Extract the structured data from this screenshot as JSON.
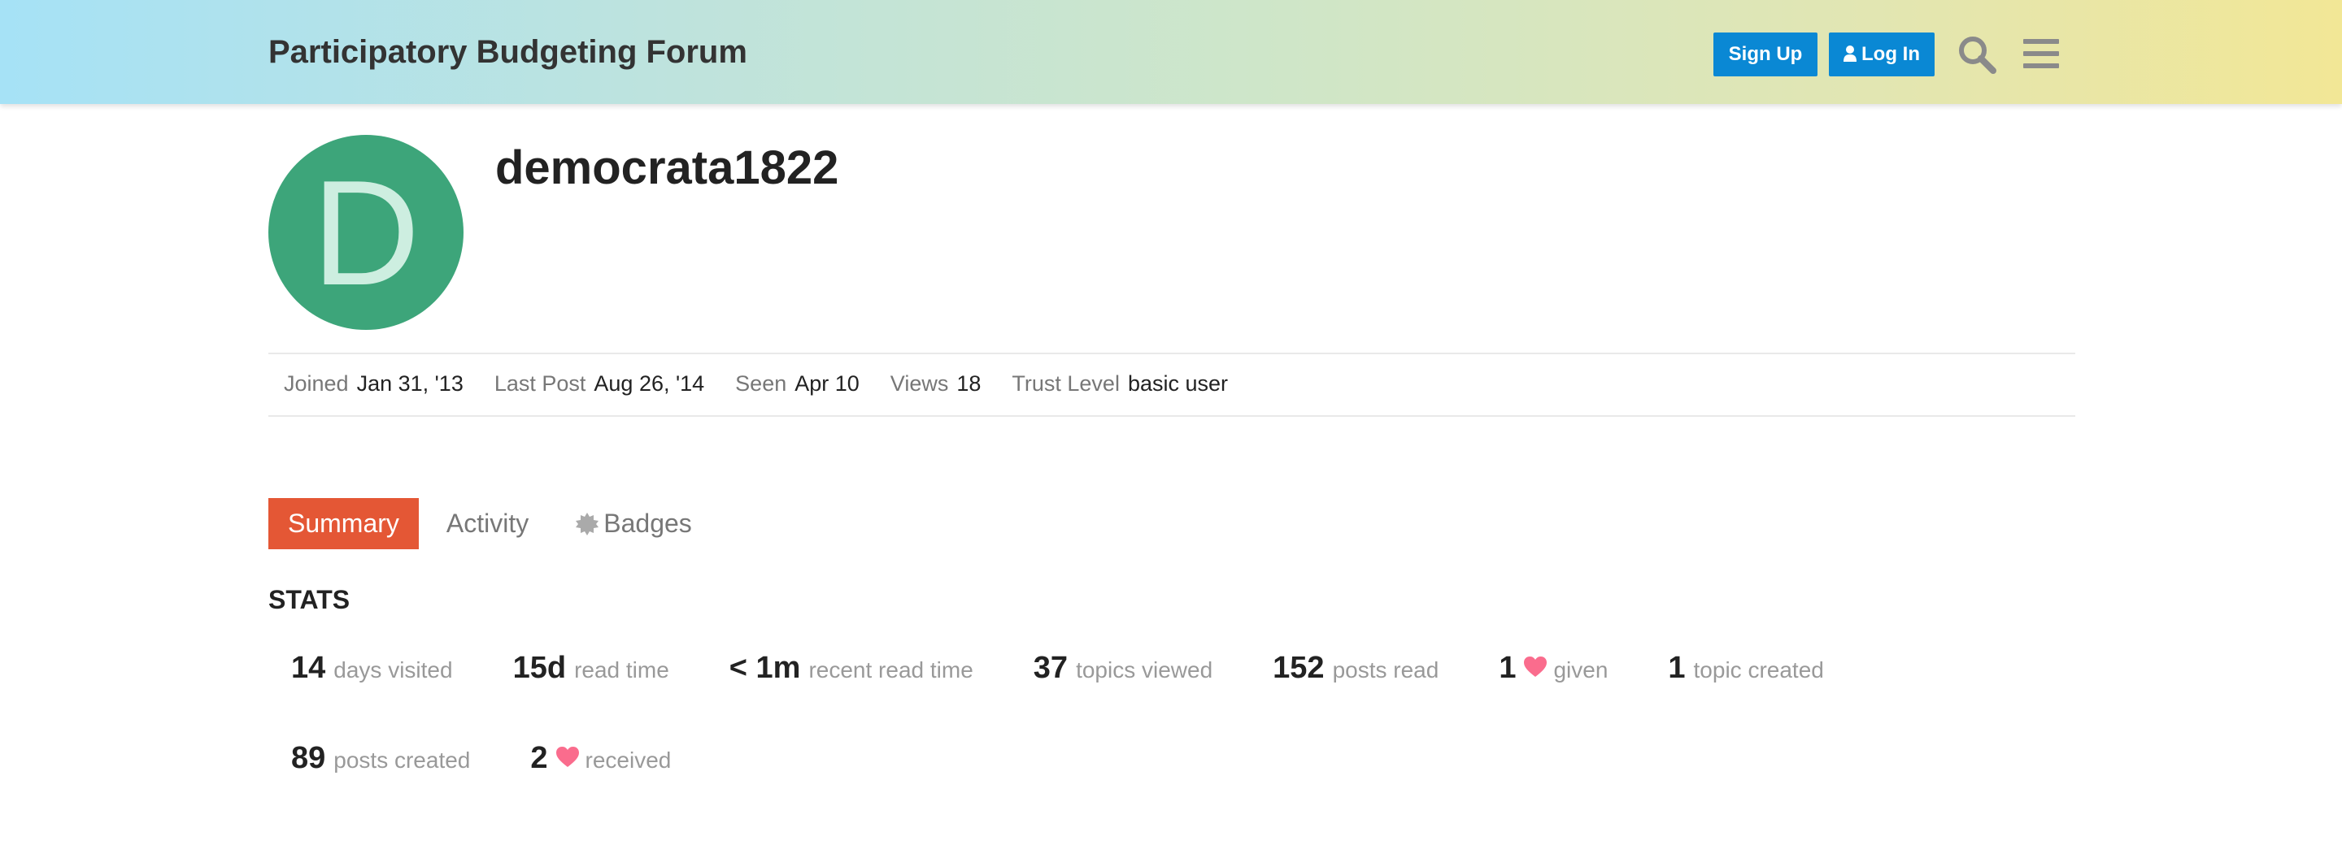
{
  "header": {
    "site_title": "Participatory Budgeting Forum",
    "signup_label": "Sign Up",
    "login_label": "Log In",
    "icons": [
      "user-icon",
      "search-icon",
      "hamburger-menu-icon"
    ]
  },
  "profile": {
    "avatar_letter": "D",
    "avatar_color": "#3da57a",
    "username": "democrata1822",
    "meta": [
      {
        "label": "Joined",
        "value": "Jan 31, '13"
      },
      {
        "label": "Last Post",
        "value": "Aug 26, '14"
      },
      {
        "label": "Seen",
        "value": "Apr 10"
      },
      {
        "label": "Views",
        "value": "18"
      },
      {
        "label": "Trust Level",
        "value": "basic user"
      }
    ]
  },
  "tabs": {
    "summary": "Summary",
    "activity": "Activity",
    "badges": "Badges",
    "active_color": "#e45735"
  },
  "stats": {
    "heading": "STATS",
    "items": [
      {
        "value": "14",
        "label": "days visited"
      },
      {
        "value": "15d",
        "label": "read time"
      },
      {
        "value": "< 1m",
        "label": "recent read time"
      },
      {
        "value": "37",
        "label": "topics viewed"
      },
      {
        "value": "152",
        "label": "posts read"
      },
      {
        "value": "1",
        "label": "given",
        "icon": "heart-icon"
      },
      {
        "value": "1",
        "label": "topic created"
      },
      {
        "value": "89",
        "label": "posts created"
      },
      {
        "value": "2",
        "label": "received",
        "icon": "heart-icon"
      }
    ],
    "heart_color": "#fa6c8d"
  }
}
